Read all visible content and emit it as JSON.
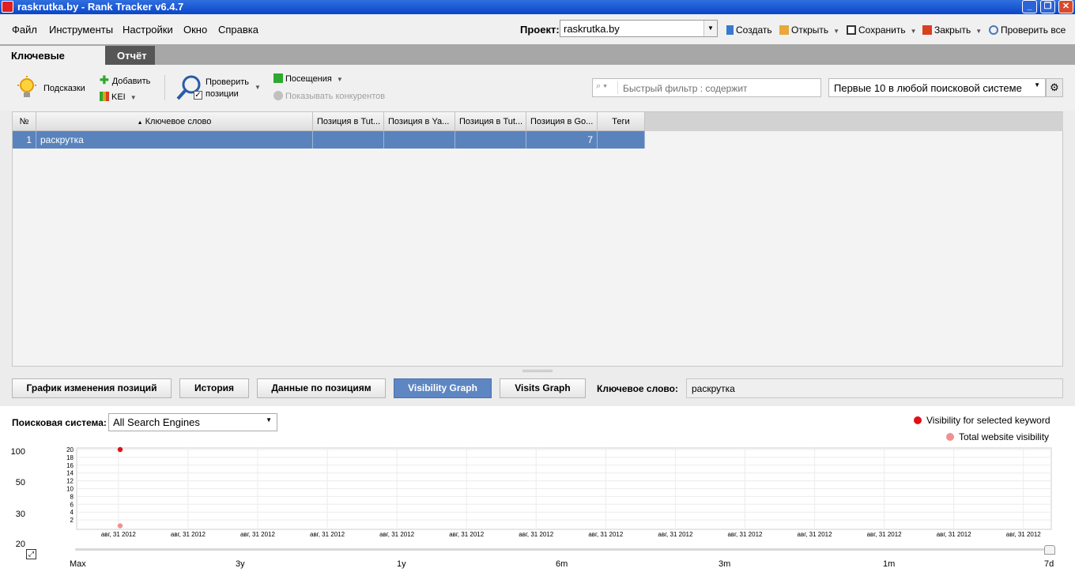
{
  "window": {
    "title": "raskrutka.by - Rank Tracker v6.4.7"
  },
  "menu": [
    "Файл",
    "Инструменты",
    "Настройки",
    "Окно",
    "Справка"
  ],
  "project": {
    "label": "Проект:",
    "value": "raskrutka.by",
    "create": "Создать",
    "open": "Открыть",
    "save": "Сохранить",
    "close": "Закрыть",
    "check_all": "Проверить все"
  },
  "tabs": {
    "keywords": "Ключевые слова",
    "report": "Отчёт"
  },
  "toolbar": {
    "hints": "Подсказки",
    "add": "Добавить",
    "kei": "KEI",
    "check_line1": "Проверить",
    "check_line2": "позиции",
    "visits": "Посещения",
    "show_competitors": "Показывать конкурентов",
    "filter_placeholder": "Быстрый фильтр : содержит",
    "top_select": "Первые 10 в любой поисковой системе"
  },
  "table": {
    "headers": [
      "№",
      "Ключевое слово",
      "Позиция в Tut...",
      "Позиция в Ya...",
      "Позиция в Tut...",
      "Позиция в Go...",
      "Теги"
    ],
    "rows": [
      {
        "num": "1",
        "keyword": "раскрутка",
        "pos1": "",
        "pos2": "",
        "pos3": "",
        "pos4": "7",
        "tags": ""
      }
    ]
  },
  "bottom_tabs": {
    "position_graph": "График изменения позиций",
    "history": "История",
    "position_data": "Данные по позициям",
    "visibility_graph": "Visibility Graph",
    "visits_graph": "Visits Graph",
    "keyword_label": "Ключевое слово:",
    "keyword_value": "раскрутка"
  },
  "search_engine": {
    "label": "Поисковая система:",
    "value": "All Search Engines"
  },
  "legend": {
    "selected": "Visibility for selected keyword",
    "total": "Total website visibility"
  },
  "colors": {
    "selected": "#e0101a",
    "total": "#f09090",
    "selection": "#5a83bd"
  },
  "chart_data": {
    "type": "scatter",
    "y_ticks": [
      "2",
      "4",
      "6",
      "8",
      "10",
      "12",
      "14",
      "16",
      "18",
      "20"
    ],
    "ylim": [
      0,
      20
    ],
    "left_axis_ticks": [
      "100",
      "50",
      "30",
      "20"
    ],
    "x_ticks": [
      "авг, 31 2012",
      "авг, 31 2012",
      "авг, 31 2012",
      "авг, 31 2012",
      "авг, 31 2012",
      "авг, 31 2012",
      "авг, 31 2012",
      "авг, 31 2012",
      "авг, 31 2012",
      "авг, 31 2012",
      "авг, 31 2012",
      "авг, 31 2012",
      "авг, 31 2012",
      "авг, 31 2012"
    ],
    "series": [
      {
        "name": "Visibility for selected keyword",
        "values": [
          20
        ]
      },
      {
        "name": "Total website visibility",
        "values": [
          0.5
        ]
      }
    ],
    "grid": true
  },
  "timeline": [
    "Max",
    "3y",
    "1y",
    "6m",
    "3m",
    "1m",
    "7d"
  ]
}
